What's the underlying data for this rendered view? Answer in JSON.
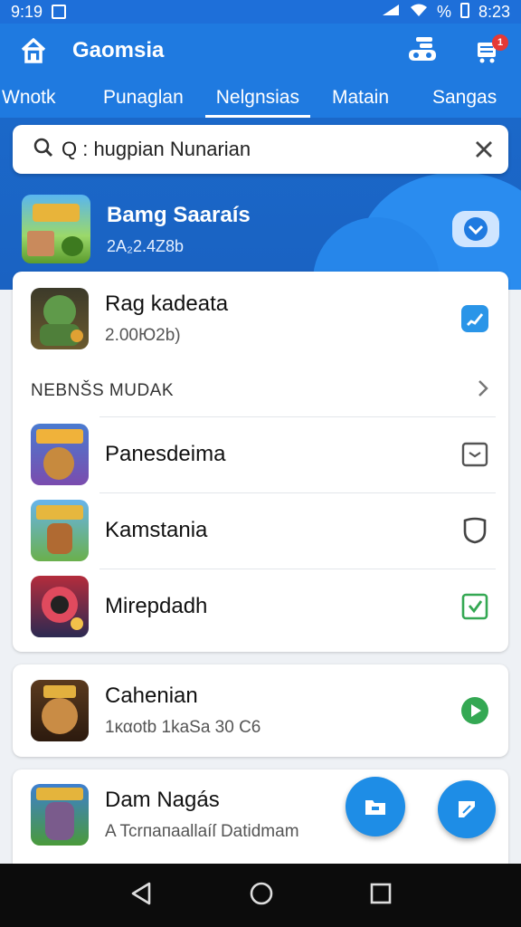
{
  "status_bar": {
    "time_left": "9:19",
    "battery": "%",
    "time_right": "8:23"
  },
  "app_bar": {
    "title": "Gaomsia",
    "cart_badge": "1",
    "tabs": [
      {
        "label": "Wnotk",
        "active": false
      },
      {
        "label": "Punaglan",
        "active": false
      },
      {
        "label": "Nelgnsias",
        "active": true
      },
      {
        "label": "Matain",
        "active": false
      },
      {
        "label": "Sangas",
        "active": false
      }
    ]
  },
  "search": {
    "value": "Q : hugpian Nunarian"
  },
  "featured": {
    "title": "Bamg Saaraís",
    "subtitle": "2A₂2.4Z8b"
  },
  "card_top": {
    "title": "Rag kadeata",
    "subtitle": "2.00Ю2b)"
  },
  "section": {
    "title": "NEBNŠS MUDAK"
  },
  "list_items": [
    {
      "title": "Panesdeima"
    },
    {
      "title": "Kamstania"
    },
    {
      "title": "Mirepdadh"
    }
  ],
  "card_mid": {
    "title": "Cahenian",
    "subtitle": "1καotb 1kaSa 30 C6"
  },
  "card_bottom": {
    "title": "Dam Nagás",
    "subtitle": "A Tcrпaпaallaíſ Datidmam"
  },
  "colors": {
    "primary": "#1f7ae0",
    "accent_green": "#34a853",
    "fab": "#1e8de6"
  }
}
